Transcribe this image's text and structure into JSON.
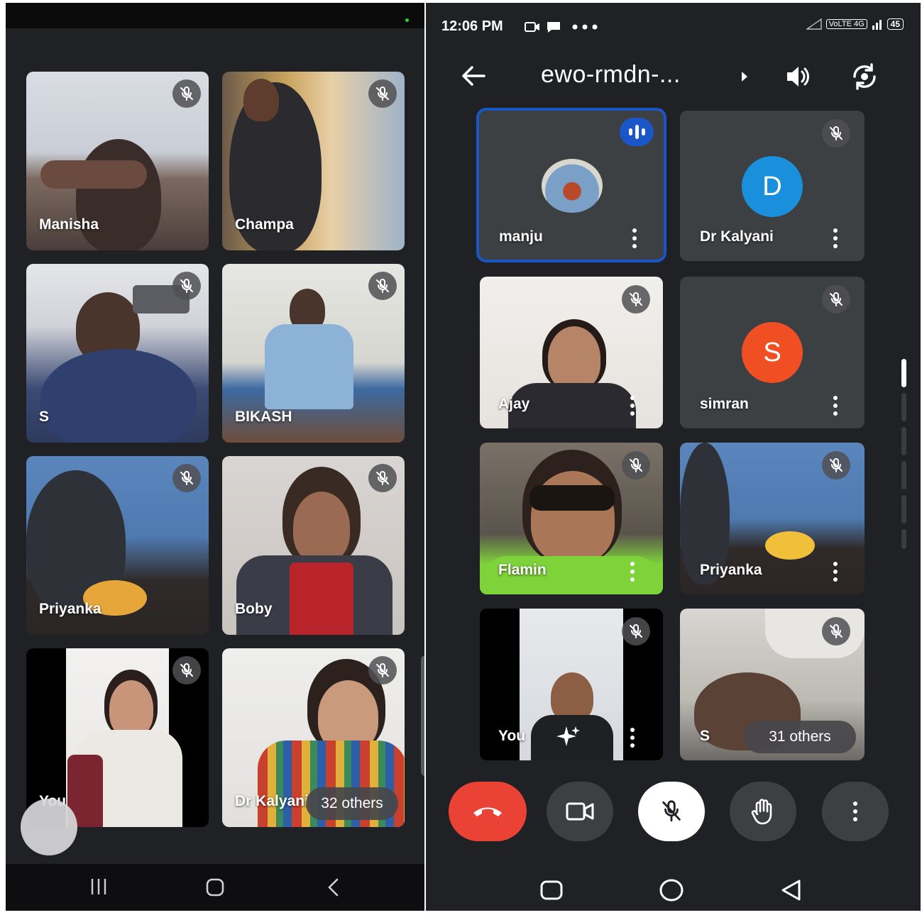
{
  "left_screen": {
    "tiles": [
      {
        "name": "Manisha"
      },
      {
        "name": "Champa"
      },
      {
        "name": "S"
      },
      {
        "name": "BIKASH"
      },
      {
        "name": "Priyanka"
      },
      {
        "name": "Boby"
      },
      {
        "name": "You"
      },
      {
        "name": "Dr Kalyani"
      }
    ],
    "others_label": "32 others"
  },
  "right_screen": {
    "status": {
      "time": "12:06 PM",
      "network": "VoLTE 4G",
      "battery": "45"
    },
    "meeting_code": "ewo-rmdn-...",
    "tiles": [
      {
        "name": "manju",
        "speaking": true
      },
      {
        "name": "Dr Kalyani",
        "avatar_letter": "D",
        "avatar_color": "#1a8fdc"
      },
      {
        "name": "Ajay"
      },
      {
        "name": "simran",
        "avatar_letter": "S",
        "avatar_color": "#f04e23"
      },
      {
        "name": "Flamin"
      },
      {
        "name": "Priyanka"
      },
      {
        "name": "You"
      },
      {
        "name": "S"
      }
    ],
    "others_label": "31 others"
  },
  "icons": {
    "mic_off": "mic-off-icon",
    "more": "more-vert-icon",
    "back": "arrow-back-icon",
    "speaker": "speaker-icon",
    "switch_camera": "switch-camera-icon",
    "end_call": "end-call-icon",
    "camera": "camera-icon",
    "raise_hand": "raise-hand-icon"
  },
  "colors": {
    "background": "#202124",
    "tile_bg": "#3c4043",
    "end_call": "#ea4335",
    "speaking_border": "#1a56c8"
  }
}
